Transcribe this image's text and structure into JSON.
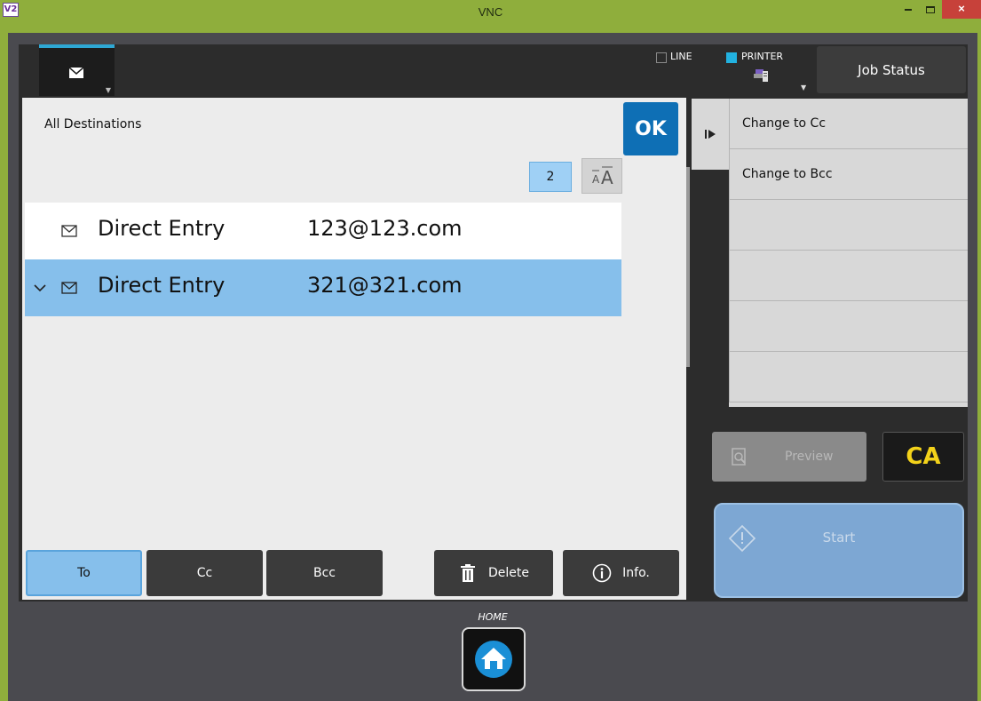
{
  "window": {
    "app_logo": "V2",
    "title": "VNC",
    "controls": {
      "close_symbol": "×"
    }
  },
  "header": {
    "mode_tab": {
      "icon": "mail-icon"
    },
    "line": {
      "label": "LINE",
      "checked": false
    },
    "printer": {
      "label": "PRINTER",
      "checked": true,
      "icon": "printer-icon"
    },
    "job_status_label": "Job Status"
  },
  "destinations": {
    "title": "All Destinations",
    "ok_label": "OK",
    "count": "2",
    "font_size_icon": "text-size-icon",
    "rows": [
      {
        "type": "Direct Entry",
        "address": "123@123.com",
        "selected": false
      },
      {
        "type": "Direct Entry",
        "address": "321@321.com",
        "selected": true
      }
    ],
    "buttons": {
      "to": "To",
      "cc": "Cc",
      "bcc": "Bcc",
      "delete": "Delete",
      "info": "Info."
    }
  },
  "side_menu": {
    "items": [
      "Change to Cc",
      "Change to Bcc",
      "",
      "",
      "",
      ""
    ]
  },
  "actions": {
    "preview_label": "Preview",
    "ca_label": "CA",
    "start_label": "Start"
  },
  "home": {
    "label": "HOME"
  },
  "colors": {
    "accent_blue": "#0e6fb5",
    "selection_blue": "#86bfeb",
    "printer_cyan": "#22b2e0",
    "ca_yellow": "#f3d21a",
    "window_green": "#8fae3c"
  }
}
